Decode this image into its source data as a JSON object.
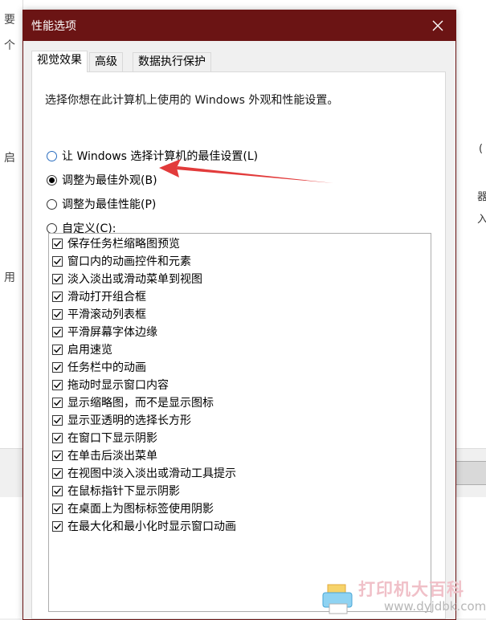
{
  "dialog": {
    "title": "性能选项",
    "tabs": [
      {
        "label": "视觉效果",
        "active": true
      },
      {
        "label": "高级",
        "active": false
      },
      {
        "label": "数据执行保护",
        "active": false
      }
    ],
    "description": "选择你想在此计算机上使用的 Windows 外观和性能设置。",
    "radio_options": [
      {
        "label": "让 Windows 选择计算机的最佳设置(L)",
        "checked": false
      },
      {
        "label": "调整为最佳外观(B)",
        "checked": true
      },
      {
        "label": "调整为最佳性能(P)",
        "checked": false
      },
      {
        "label": "自定义(C):",
        "checked": false
      }
    ],
    "effects": [
      {
        "label": "保存任务栏缩略图预览",
        "checked": true
      },
      {
        "label": "窗口内的动画控件和元素",
        "checked": true
      },
      {
        "label": "淡入淡出或滑动菜单到视图",
        "checked": true
      },
      {
        "label": "滑动打开组合框",
        "checked": true
      },
      {
        "label": "平滑滚动列表框",
        "checked": true
      },
      {
        "label": "平滑屏幕字体边缘",
        "checked": true
      },
      {
        "label": "启用速览",
        "checked": true
      },
      {
        "label": "任务栏中的动画",
        "checked": true
      },
      {
        "label": "拖动时显示窗口内容",
        "checked": true
      },
      {
        "label": "显示缩略图，而不是显示图标",
        "checked": true
      },
      {
        "label": "显示亚透明的选择长方形",
        "checked": true
      },
      {
        "label": "在窗口下显示阴影",
        "checked": true
      },
      {
        "label": "在单击后淡出菜单",
        "checked": true
      },
      {
        "label": "在视图中淡入淡出或滑动工具提示",
        "checked": true
      },
      {
        "label": "在鼠标指针下显示阴影",
        "checked": true
      },
      {
        "label": "在桌面上为图标标签使用阴影",
        "checked": true
      },
      {
        "label": "在最大化和最小化时显示窗口动画",
        "checked": true
      }
    ]
  },
  "background": {
    "left_chars": [
      "要",
      "个",
      "启",
      "用"
    ],
    "right_chars": [
      "(",
      "器",
      "入"
    ]
  },
  "watermark": {
    "text": "打印机大百科",
    "url": "www.dyjdbk.com"
  },
  "colors": {
    "titlebar": "#6b1414",
    "arrow": "#e23b3b",
    "accent_radio": "#2a6dbf"
  },
  "icons": {
    "close": "close-icon",
    "check": "checkmark-icon",
    "arrow": "red-arrow-annotation",
    "logo": "printer-logo-icon"
  }
}
